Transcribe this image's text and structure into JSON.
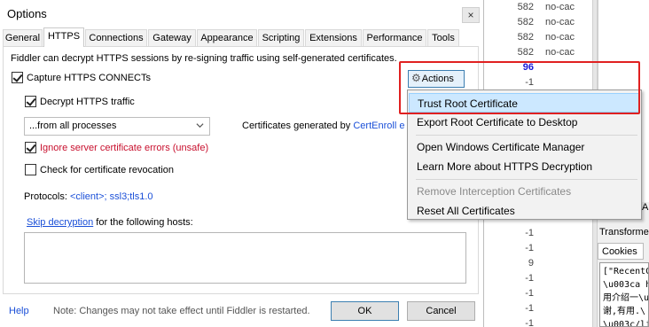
{
  "dialog": {
    "title": "Options",
    "close_glyph": "×",
    "tabs": [
      "General",
      "HTTPS",
      "Connections",
      "Gateway",
      "Appearance",
      "Scripting",
      "Extensions",
      "Performance",
      "Tools"
    ],
    "active_tab": "HTTPS",
    "description": "Fiddler can decrypt HTTPS sessions by re-signing traffic using self-generated certificates.",
    "capture_connects": {
      "label": "Capture HTTPS CONNECTs",
      "checked": true
    },
    "decrypt_traffic": {
      "label": "Decrypt HTTPS traffic",
      "checked": true
    },
    "process_filter": {
      "value": "...from all processes"
    },
    "cert_generated_prefix": "Certificates generated by",
    "cert_generator": "CertEnroll",
    "cert_generator_tail": "e",
    "ignore_errors": {
      "label": "Ignore server certificate errors (unsafe)",
      "checked": true
    },
    "check_revocation": {
      "label": "Check for certificate revocation",
      "checked": false
    },
    "protocols_label": "Protocols:",
    "protocols_value": "<client>; ssl3;tls1.0",
    "skip_decryption_link": "Skip decryption",
    "skip_decryption_text": "for the following hosts:",
    "hosts_value": "",
    "actions_label": "Actions",
    "help_label": "Help",
    "note": "Note: Changes may not take effect until Fiddler is restarted.",
    "ok_label": "OK",
    "cancel_label": "Cancel"
  },
  "actions_menu": {
    "items": [
      {
        "label": "Trust Root Certificate",
        "selected": true,
        "enabled": true
      },
      {
        "label": "Export Root Certificate to Desktop",
        "selected": false,
        "enabled": true
      },
      {
        "label": "Open Windows Certificate Manager",
        "selected": false,
        "enabled": true
      },
      {
        "label": "Learn More about HTTPS Decryption",
        "selected": false,
        "enabled": true
      },
      {
        "label": "Remove Interception Certificates",
        "selected": false,
        "enabled": false
      },
      {
        "label": "Reset All Certificates",
        "selected": false,
        "enabled": true
      }
    ]
  },
  "background": {
    "session_rows": [
      {
        "value": "582",
        "cache": "no-cac"
      },
      {
        "value": "582",
        "cache": "no-cac"
      },
      {
        "value": "582",
        "cache": "no-cac"
      },
      {
        "value": "582",
        "cache": "no-cac"
      },
      {
        "value": "96",
        "cache": ""
      },
      {
        "value": "-1",
        "cache": ""
      },
      {
        "value": "-1",
        "cache": ""
      },
      {
        "value": "-1",
        "cache": ""
      },
      {
        "value": "9",
        "cache": ""
      },
      {
        "value": "-1",
        "cache": ""
      },
      {
        "value": "-1",
        "cache": ""
      },
      {
        "value": "-1",
        "cache": ""
      },
      {
        "value": "-1",
        "cache": ""
      }
    ],
    "a_tab": "A",
    "transformer_label": "Transforme",
    "cookies_tab": "Cookies",
    "raw_lines": [
      "[\"RecentC",
      "\\u003ca h",
      "用介绍一\\u",
      "谢,有用.\\",
      "\\u003c/li"
    ]
  },
  "colors": {
    "highlight": "#e02020",
    "link": "#1a4fd8",
    "warning_text": "#c8102e",
    "menu_selected": "#cce8ff"
  }
}
